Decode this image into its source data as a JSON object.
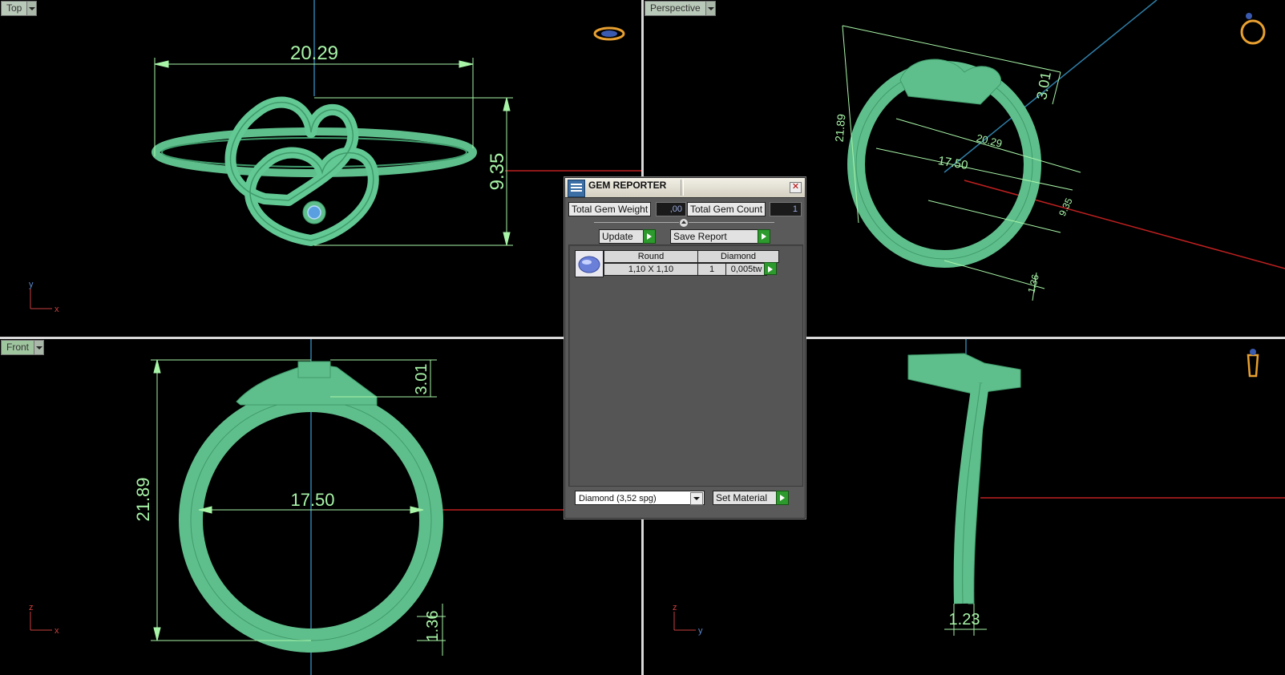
{
  "viewports": {
    "top": {
      "label": "Top",
      "axis_h": "x",
      "axis_v": "y"
    },
    "persp": {
      "label": "Perspective"
    },
    "front": {
      "label": "Front",
      "axis_h": "x",
      "axis_v": "z"
    },
    "right": {
      "axis_h": "y",
      "axis_v": "z"
    }
  },
  "dimensions": {
    "top_width": "20.29",
    "top_height": "9.35",
    "persp_outer": "21.89",
    "persp_height": "3.01",
    "persp_width": "20.29",
    "persp_inner": "17.50",
    "persp_depth": "9.35",
    "persp_band": "1.36",
    "front_outer": "21.89",
    "front_inner": "17.50",
    "front_top": "3.01",
    "front_band": "1.36",
    "right_band": "1.23"
  },
  "colors": {
    "model": "#5fbf8c",
    "dimension": "#a8f5a8",
    "axis_red": "#c02020",
    "axis_blue": "#2f7fa8"
  },
  "gem_reporter": {
    "title": "GEM REPORTER",
    "total_weight_label": "Total Gem Weight",
    "total_weight_value": ",00",
    "total_count_label": "Total Gem Count",
    "total_count_value": "1",
    "update_label": "Update",
    "save_report_label": "Save Report",
    "gems": [
      {
        "shape": "Round",
        "material": "Diamond",
        "size": "1,10 X 1,10",
        "count": "1",
        "weight": "0,005tw"
      }
    ],
    "material_select_value": "Diamond    (3,52 spg)",
    "set_material_label": "Set Material"
  }
}
